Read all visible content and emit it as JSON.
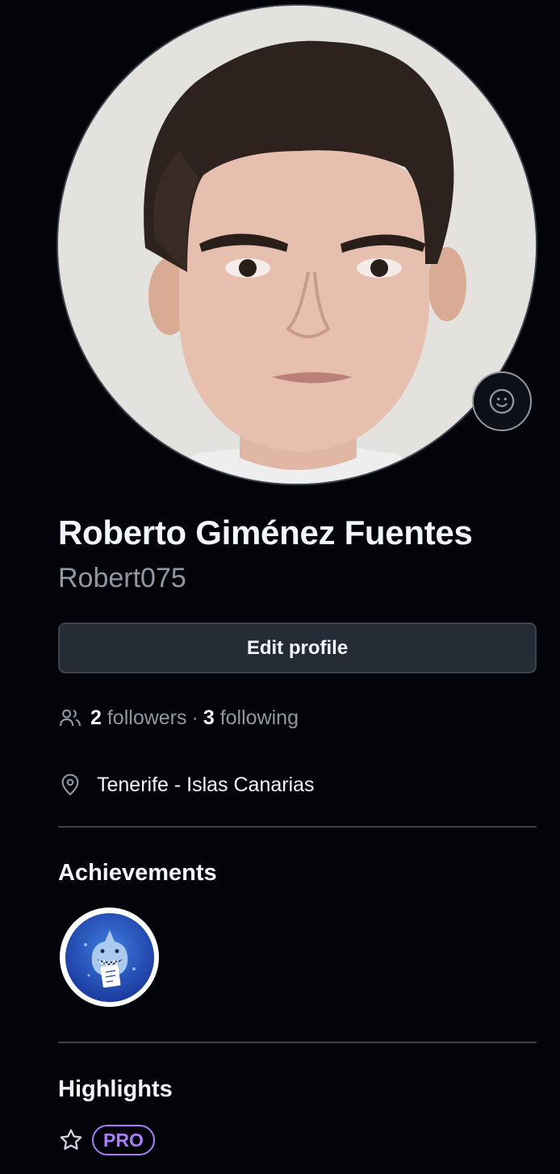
{
  "profile": {
    "full_name": "Roberto Giménez Fuentes",
    "username": "Robert075",
    "edit_label": "Edit profile",
    "followers_count": "2",
    "followers_label": "followers",
    "separator": "·",
    "following_count": "3",
    "following_label": "following",
    "location": "Tenerife - Islas Canarias"
  },
  "achievements": {
    "title": "Achievements"
  },
  "highlights": {
    "title": "Highlights",
    "pro_label": "PRO"
  },
  "colors": {
    "background": "#02040a",
    "accent_purple": "#ab7df8",
    "muted_text": "#9198a1",
    "button_bg": "#262c36"
  },
  "icons": {
    "status": "smiley-icon",
    "people": "people-icon",
    "location": "location-pin-icon",
    "achievement": "pull-shark-badge-icon",
    "highlight": "star-icon"
  }
}
